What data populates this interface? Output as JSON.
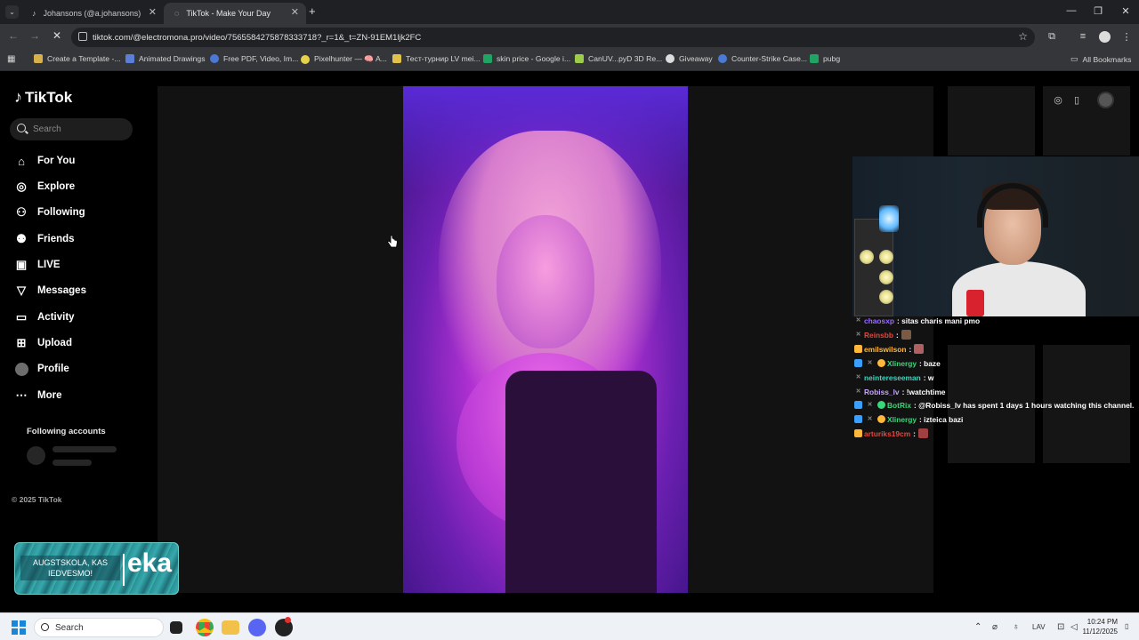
{
  "browser": {
    "tabs": [
      {
        "title": "Johansons (@a.johansons) | Tik",
        "active": false
      },
      {
        "title": "TikTok - Make Your Day",
        "active": true
      }
    ],
    "url": "tiktok.com/@electromona.pro/video/7565584275878333718?_r=1&_t=ZN-91EM1ljk2FC",
    "bookmarks": [
      {
        "label": "Create a Template -...",
        "color": "#d6b04a"
      },
      {
        "label": "Animated Drawings",
        "color": "#5b7fd6"
      },
      {
        "label": "Free PDF, Video, Im...",
        "color": "#4a78d8"
      },
      {
        "label": "Pixelhunter — 🧠 A...",
        "color": "#e6d24a"
      },
      {
        "label": "Тест-турнир LV mei...",
        "color": "#e0c24a"
      },
      {
        "label": "skin price - Google i...",
        "color": "#1fa463"
      },
      {
        "label": "CanUV...pyD 3D Re...",
        "color": "#9ccc4a"
      },
      {
        "label": "Giveaway",
        "color": "#dddddd"
      },
      {
        "label": "Counter-Strike Case...",
        "color": "#4a7ad6"
      },
      {
        "label": "pubg",
        "color": "#1fa463"
      }
    ],
    "all_bookmarks": "All Bookmarks"
  },
  "tiktok": {
    "logo": "TikTok",
    "search_placeholder": "Search",
    "nav": [
      {
        "label": "For You",
        "icon": "home-icon"
      },
      {
        "label": "Explore",
        "icon": "compass-icon"
      },
      {
        "label": "Following",
        "icon": "following-icon"
      },
      {
        "label": "Friends",
        "icon": "friends-icon"
      },
      {
        "label": "LIVE",
        "icon": "live-icon"
      },
      {
        "label": "Messages",
        "icon": "messages-icon"
      },
      {
        "label": "Activity",
        "icon": "activity-icon"
      },
      {
        "label": "Upload",
        "icon": "upload-icon"
      },
      {
        "label": "Profile",
        "icon": "avatar"
      },
      {
        "label": "More",
        "icon": "more-icon"
      }
    ],
    "following_accounts": "Following accounts",
    "copyright": "© 2025 TikTok"
  },
  "chat": [
    {
      "user": "chaosxp",
      "user_color": "#9b6bff",
      "msg": ": sitas charis mani pmo",
      "badge": "",
      "emote": ""
    },
    {
      "user": "Reinsbb",
      "user_color": "#e0483e",
      "msg": ":",
      "badge": "",
      "emote": "#7b5a44"
    },
    {
      "user": "emilswilson",
      "user_color": "#ffb83a",
      "msg": ":",
      "badge": "#ffb83a",
      "emote": "#b06060"
    },
    {
      "user": "Xlinergy",
      "user_color": "#3ad77a",
      "msg": ": baze",
      "badge": "#3aa0ff",
      "emote": ""
    },
    {
      "user": "neintereseeman",
      "user_color": "#3ad7c0",
      "msg": ": w",
      "badge": "",
      "emote": ""
    },
    {
      "user": "Robiss_lv",
      "user_color": "#c7a4ff",
      "msg": ": !watchtime",
      "badge": "",
      "emote": ""
    },
    {
      "user": "BotRix",
      "user_color": "#3ad77a",
      "msg": ": @Robiss_lv has spent 1 days 1 hours watching this channel.",
      "badge": "#3aa0ff",
      "emote": ""
    },
    {
      "user": "Xlinergy",
      "user_color": "#3ad77a",
      "msg": ": izteica bazi",
      "badge": "#3aa0ff",
      "emote": ""
    },
    {
      "user": "arturiks19cm",
      "user_color": "#e0483e",
      "msg": ":",
      "badge": "#ffb83a",
      "emote": "#a04040"
    }
  ],
  "ad": {
    "text": "AUGSTSKOLA, KAS IEDVESMO!",
    "brand": "eka"
  },
  "taskbar": {
    "search_placeholder": "Search",
    "lang": "LAV",
    "time": "10:24 PM",
    "date": "11/12/2025"
  }
}
